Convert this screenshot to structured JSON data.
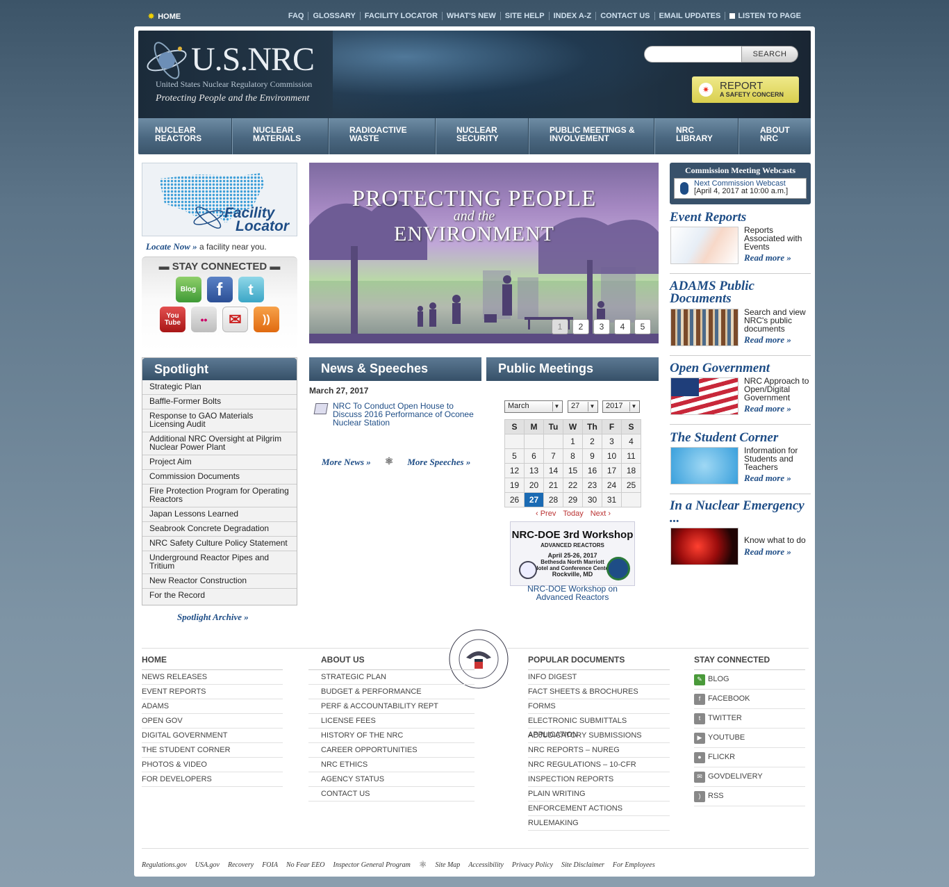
{
  "util": {
    "home": "HOME",
    "links": [
      "FAQ",
      "GLOSSARY",
      "FACILITY LOCATOR",
      "WHAT'S NEW",
      "SITE HELP",
      "INDEX A-Z",
      "CONTACT US",
      "EMAIL UPDATES",
      "LISTEN TO PAGE"
    ]
  },
  "header": {
    "brand": "U.S.NRC",
    "full_name": "United States Nuclear Regulatory Commission",
    "tagline": "Protecting People and the Environment",
    "search_button": "SEARCH",
    "search_placeholder": "",
    "report_line1": "REPORT",
    "report_line2": "A SAFETY CONCERN"
  },
  "nav": [
    {
      "l1": "NUCLEAR",
      "l2": "REACTORS"
    },
    {
      "l1": "NUCLEAR",
      "l2": "MATERIALS"
    },
    {
      "l1": "RADIOACTIVE",
      "l2": "WASTE"
    },
    {
      "l1": "NUCLEAR",
      "l2": "SECURITY"
    },
    {
      "l1": "PUBLIC MEETINGS &",
      "l2": "INVOLVEMENT"
    },
    {
      "l1": "NRC",
      "l2": "LIBRARY"
    },
    {
      "l1": "ABOUT",
      "l2": "NRC"
    }
  ],
  "facility": {
    "line1": "Facility",
    "line2": "Locator",
    "locate_link": "Locate Now »",
    "locate_text": " a facility near you."
  },
  "stay": {
    "title": "STAY CONNECTED",
    "icons": [
      "blog-icon",
      "facebook-icon",
      "twitter-icon",
      "youtube-icon",
      "flickr-icon",
      "govdelivery-icon",
      "rss-icon"
    ],
    "labels": [
      "Blog",
      "f",
      "t",
      "You Tube",
      "••",
      "✉",
      "))"
    ]
  },
  "spotlight": {
    "title": "Spotlight",
    "items": [
      "Strategic Plan",
      "Baffle-Former Bolts",
      "Response to GAO Materials Licensing Audit",
      "Additional NRC Oversight at Pilgrim Nuclear Power Plant",
      "Project Aim",
      "Commission Documents",
      "Fire Protection Program for Operating Reactors",
      "Japan Lessons Learned",
      "Seabrook Concrete Degradation",
      "NRC Safety Culture Policy Statement",
      "Underground Reactor Pipes and Tritium",
      "New Reactor Construction",
      "For the Record"
    ],
    "archive": "Spotlight Archive »"
  },
  "hero": {
    "line1": "PROTECTING PEOPLE",
    "line2": "and the",
    "line3": "ENVIRONMENT",
    "pages": [
      "1",
      "2",
      "3",
      "4",
      "5"
    ]
  },
  "news": {
    "title": "News & Speeches",
    "date": "March 27, 2017",
    "item": "NRC To Conduct Open House to Discuss 2016 Performance of Oconee Nuclear Station",
    "more_news": "More News »",
    "more_speeches": "More Speeches »"
  },
  "meetings": {
    "title": "Public Meetings",
    "month": "March",
    "day": "27",
    "year": "2017",
    "weekdays": [
      "S",
      "M",
      "Tu",
      "W",
      "Th",
      "F",
      "S"
    ],
    "weeks": [
      [
        "",
        "",
        "",
        "1",
        "2",
        "3",
        "4"
      ],
      [
        "5",
        "6",
        "7",
        "8",
        "9",
        "10",
        "11"
      ],
      [
        "12",
        "13",
        "14",
        "15",
        "16",
        "17",
        "18"
      ],
      [
        "19",
        "20",
        "21",
        "22",
        "23",
        "24",
        "25"
      ],
      [
        "26",
        "27",
        "28",
        "29",
        "30",
        "31",
        ""
      ]
    ],
    "today": "27",
    "prev": "‹ Prev",
    "today_label": "Today",
    "next": "Next ›",
    "ws_title": "NRC-DOE 3rd Workshop",
    "ws_sub": "ADVANCED REACTORS",
    "ws_dates": "April 25-26, 2017",
    "ws_venue1": "Bethesda North Marriott",
    "ws_venue2": "Hotel and Conference Center",
    "ws_city": "Rockville, MD",
    "ws_caption": "NRC-DOE Workshop on Advanced Reactors"
  },
  "webcast": {
    "title": "Commission Meeting Webcasts",
    "link": "Next Commission Webcast",
    "when": "[April 4, 2017 at 10:00 a.m.]"
  },
  "right": [
    {
      "title": "Event Reports",
      "text": "Reports Associated with Events",
      "more": "Read more »"
    },
    {
      "title": "ADAMS Public Documents",
      "text": "Search and view NRC's public documents",
      "more": "Read more »"
    },
    {
      "title": "Open Government",
      "text": "NRC Approach to Open/Digital Government",
      "more": "Read more »"
    },
    {
      "title": "The Student Corner",
      "text": "Information for Students and Teachers",
      "more": "Read more »"
    },
    {
      "title": "In a Nuclear Emergency ...",
      "text": "Know what to do",
      "more": "Read more »"
    }
  ],
  "footer": {
    "home": {
      "title": "HOME",
      "items": [
        "NEWS RELEASES",
        "EVENT REPORTS",
        "ADAMS",
        "OPEN GOV",
        "DIGITAL GOVERNMENT",
        "THE STUDENT CORNER",
        "PHOTOS & VIDEO",
        "FOR DEVELOPERS"
      ]
    },
    "about": {
      "title": "ABOUT US",
      "items": [
        "STRATEGIC PLAN",
        "BUDGET & PERFORMANCE",
        "PERF & ACCOUNTABILITY REPT",
        "LICENSE FEES",
        "HISTORY OF THE NRC",
        "CAREER OPPORTUNITIES",
        "NRC ETHICS",
        "AGENCY STATUS",
        "CONTACT US"
      ]
    },
    "popular": {
      "title": "POPULAR DOCUMENTS",
      "items": [
        "INFO DIGEST",
        "FACT SHEETS & BROCHURES",
        "FORMS",
        "ELECTRONIC SUBMITTALS APPLICATION",
        "ADJUDICATORY SUBMISSIONS",
        "NRC REPORTS – NUREG",
        "NRC REGULATIONS – 10-CFR",
        "INSPECTION REPORTS",
        "PLAIN WRITING",
        "ENFORCEMENT ACTIONS",
        "RULEMAKING"
      ]
    },
    "stay": {
      "title": "STAY CONNECTED",
      "items": [
        "BLOG",
        "FACEBOOK",
        "TWITTER",
        "YOUTUBE",
        "FLICKR",
        "GOVDELIVERY",
        "RSS"
      ]
    },
    "bottom": [
      "Regulations.gov",
      "USA.gov",
      "Recovery",
      "FOIA",
      "No Fear EEO",
      "Inspector General Program",
      "Site Map",
      "Accessibility",
      "Privacy Policy",
      "Site Disclaimer",
      "For Employees"
    ]
  },
  "colors": {
    "brand_blue": "#1e4d86",
    "nav": "#4a6780",
    "report": "#e0d85c",
    "today": "#1a6ab3"
  }
}
